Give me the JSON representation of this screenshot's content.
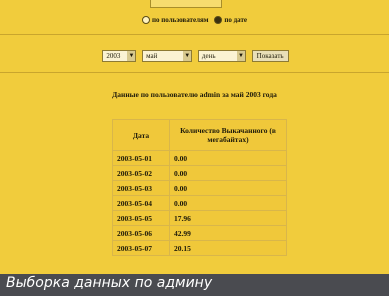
{
  "form": {
    "radio_user": "по пользователям",
    "radio_date": "по дате",
    "year_value": "2003",
    "month_value": "май",
    "period_value": "день",
    "submit_label": "Показать"
  },
  "report": {
    "heading": "Данные по пользователю admin за май 2003 года",
    "col_date": "Дата",
    "col_amount": "Количество Выкачанного (в мегабайтах)",
    "rows": [
      {
        "date": "2003-05-01",
        "amount": "0.00"
      },
      {
        "date": "2003-05-02",
        "amount": "0.00"
      },
      {
        "date": "2003-05-03",
        "amount": "0.00"
      },
      {
        "date": "2003-05-04",
        "amount": "0.00"
      },
      {
        "date": "2003-05-05",
        "amount": "17.96"
      },
      {
        "date": "2003-05-06",
        "amount": "42.99"
      },
      {
        "date": "2003-05-07",
        "amount": "20.15"
      }
    ]
  },
  "caption": "Выборка данных по админу",
  "colors": {
    "page_bg": "#f1cc3c",
    "caption_bg": "#4a4b50",
    "caption_text": "#ffffff"
  }
}
